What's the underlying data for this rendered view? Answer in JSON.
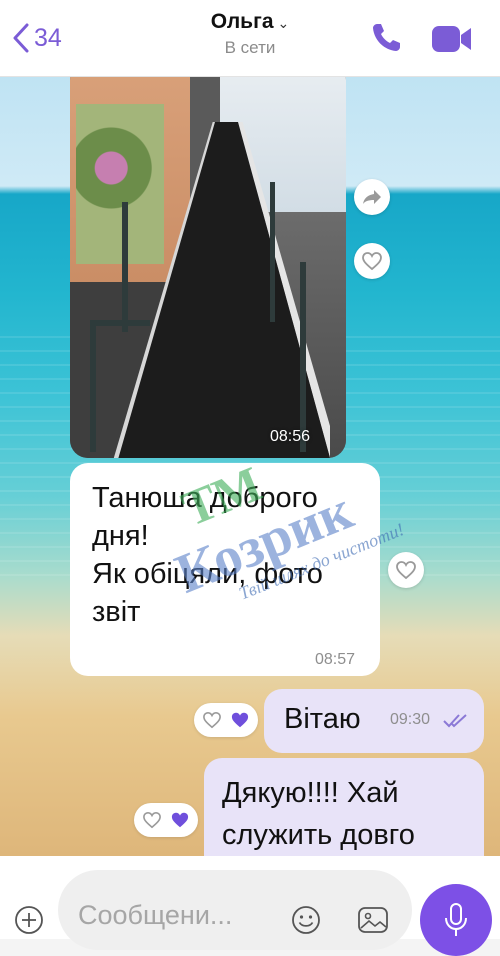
{
  "header": {
    "back_count": "34",
    "contact_name": "Ольга",
    "status": "В сети"
  },
  "messages": {
    "photo": {
      "time": "08:56"
    },
    "incoming_text": {
      "text": "Танюша доброго\nдня!\nЯк обіцяли, фото\nзвіт",
      "time": "08:57"
    },
    "outgoing_1": {
      "text": "Вітаю",
      "time": "09:30"
    },
    "outgoing_2": {
      "text": "Дякую!!!! Хай\nслужить довго"
    }
  },
  "watermark": {
    "line1": "ТМ",
    "line2": "Козрик",
    "tagline": "Твій шлях до чистоти!"
  },
  "composer": {
    "placeholder": "Сообщени..."
  },
  "colors": {
    "accent": "#7b5cd6",
    "mic_button": "#7d50e6",
    "outgoing_bubble": "#e8e3f8",
    "incoming_bubble": "#ffffff"
  },
  "icons": {
    "back": "chevron-left-icon",
    "call": "phone-icon",
    "video": "video-camera-icon",
    "forward": "forward-icon",
    "like": "heart-icon",
    "add": "plus-icon",
    "emoji": "smile-icon",
    "gallery": "gallery-icon",
    "mic": "microphone-icon",
    "read": "double-check-icon"
  }
}
